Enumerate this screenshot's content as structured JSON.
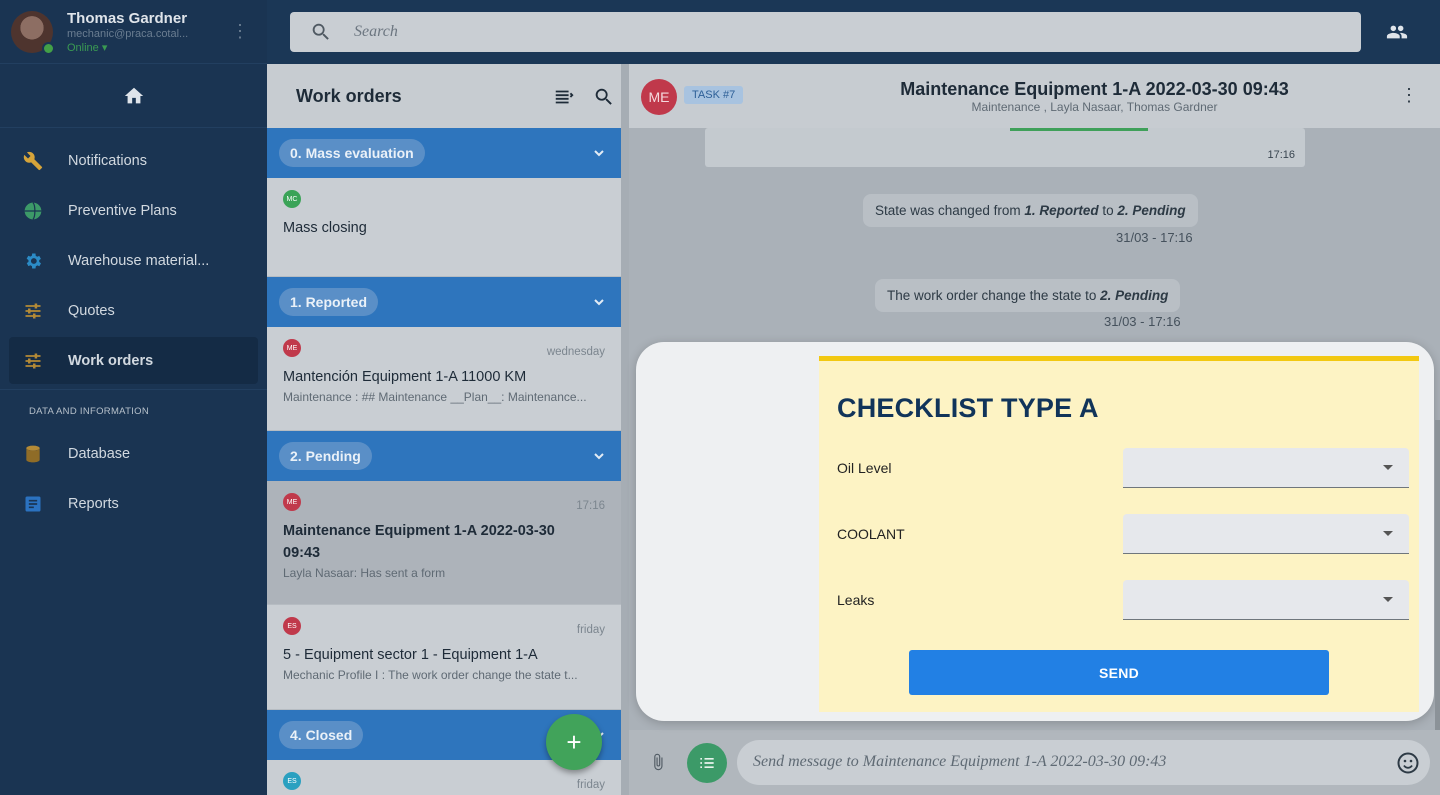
{
  "user": {
    "name": "Thomas Gardner",
    "email": "mechanic@praca.cotal...",
    "status": "Online",
    "status_caret": "▾"
  },
  "search": {
    "placeholder": "Search"
  },
  "sidebar": {
    "items": [
      {
        "label": "Notifications",
        "icon": "wrench-icon",
        "color": "#d6a43a"
      },
      {
        "label": "Preventive Plans",
        "icon": "globe-icon",
        "color": "#3c9a68"
      },
      {
        "label": "Warehouse material...",
        "icon": "gear-icon",
        "color": "#2b8bc6"
      },
      {
        "label": "Quotes",
        "icon": "sliders-icon",
        "color": "#b48a36"
      },
      {
        "label": "Work orders",
        "icon": "sliders-icon",
        "color": "#b48a36"
      }
    ],
    "section_label": "DATA AND INFORMATION",
    "data_items": [
      {
        "label": "Database",
        "icon": "database-icon",
        "color": "#b48a36"
      },
      {
        "label": "Reports",
        "icon": "report-icon",
        "color": "#2b72c0"
      }
    ]
  },
  "work_orders": {
    "title": "Work orders",
    "groups": [
      {
        "label": "0. Mass evaluation"
      },
      {
        "label": "1. Reported"
      },
      {
        "label": "2. Pending"
      },
      {
        "label": "4. Closed"
      }
    ],
    "cards": [
      {
        "badge": "MC",
        "badge_color": "#3aa357",
        "time": "",
        "title": "Mass closing",
        "sub": ""
      },
      {
        "badge": "ME",
        "badge_color": "#c0394b",
        "time": "wednesday",
        "title": "Mantención Equipment 1-A 11000 KM",
        "sub": "Maintenance : ## Maintenance __Plan__: Maintenance..."
      },
      {
        "badge": "ME",
        "badge_color": "#c0394b",
        "time": "17:16",
        "title": "Maintenance Equipment 1-A 2022-03-30 09:43",
        "sub": "Layla Nasaar: Has sent a form"
      },
      {
        "badge": "ES",
        "badge_color": "#c0394b",
        "time": "friday",
        "title": "5 - Equipment sector 1 - Equipment 1-A",
        "sub": "Mechanic Profile I : The work order change the state t..."
      },
      {
        "badge": "ES",
        "badge_color": "#2aa0c0",
        "time": "friday",
        "title": "",
        "sub": ""
      }
    ],
    "fab": "+"
  },
  "chat": {
    "avatar": "ME",
    "task_tag": "TASK #7",
    "title": "Maintenance Equipment 1-A 2022-03-30 09:43",
    "subtitle": "Maintenance , Layla Nasaar, Thomas Gardner",
    "first_time": "17:16",
    "sys1": {
      "pre": "State was changed from ",
      "from": "1. Reported",
      "mid": " to ",
      "to": "2. Pending",
      "time": "31/03 - 17:16"
    },
    "sys2": {
      "pre": "The work order change the state to ",
      "to": "2. Pending",
      "time": "31/03 - 17:16"
    },
    "input_placeholder": "Send message to Maintenance Equipment 1-A 2022-03-30 09:43"
  },
  "form": {
    "title": "CHECKLIST TYPE A",
    "fields": [
      {
        "label": "Oil Level",
        "value": ""
      },
      {
        "label": "COOLANT",
        "value": ""
      },
      {
        "label": "Leaks",
        "value": ""
      }
    ],
    "send_label": "SEND"
  }
}
